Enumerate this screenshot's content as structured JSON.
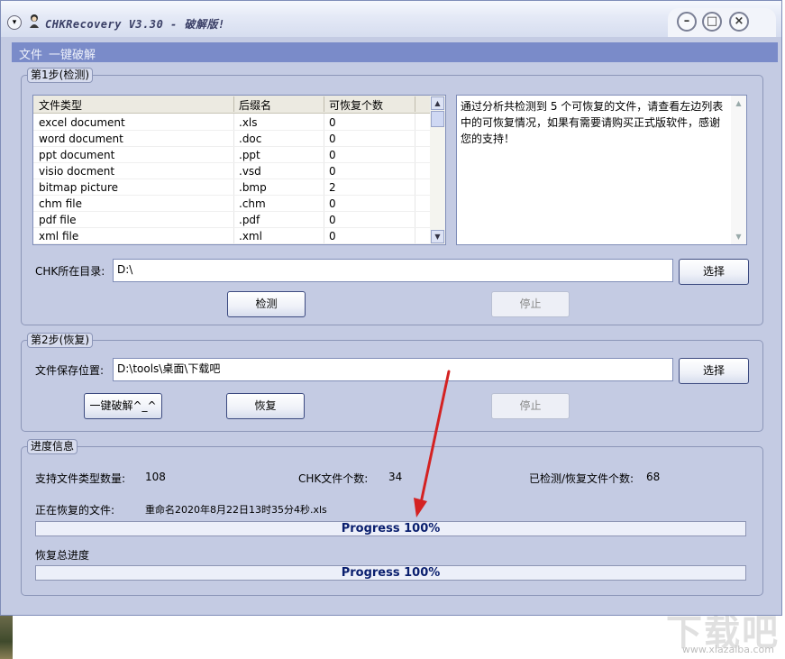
{
  "window": {
    "title": "CHKRecovery V3.30 - 破解版!"
  },
  "menu": [
    "文件",
    "一键破解"
  ],
  "step1": {
    "title": "第1步(检测)",
    "columns": [
      "文件类型",
      "后缀名",
      "可恢复个数"
    ],
    "rows": [
      [
        "excel document",
        ".xls",
        "0"
      ],
      [
        "word document",
        ".doc",
        "0"
      ],
      [
        "ppt document",
        ".ppt",
        "0"
      ],
      [
        "visio docment",
        ".vsd",
        "0"
      ],
      [
        "bitmap picture",
        ".bmp",
        "2"
      ],
      [
        "chm file",
        ".chm",
        "0"
      ],
      [
        "pdf file",
        ".pdf",
        "0"
      ],
      [
        "xml file",
        ".xml",
        "0"
      ]
    ],
    "info_text": "通过分析共检测到 5 个可恢复的文件，请查看左边列表中的可恢复情况，如果有需要请购买正式版软件，感谢您的支持！",
    "chk_dir_label": "CHK所在目录:",
    "chk_dir_value": "D:\\",
    "browse_label": "选择",
    "detect_label": "检测",
    "stop_label": "停止"
  },
  "step2": {
    "title": "第2步(恢复)",
    "save_label": "文件保存位置:",
    "save_value": "D:\\tools\\桌面\\下载吧",
    "browse_label": "选择",
    "crack_label": "一键破解^_^",
    "recover_label": "恢复",
    "stop_label": "停止"
  },
  "progress": {
    "title": "进度信息",
    "supported_types_label": "支持文件类型数量:",
    "supported_types_value": "108",
    "chk_count_label": "CHK文件个数:",
    "chk_count_value": "34",
    "detected_label": "已检测/恢复文件个数:",
    "detected_value": "68",
    "current_file_label": "正在恢复的文件:",
    "current_file_value": "重命名2020年8月22日13时35分4秒.xls",
    "file_progress_text": "Progress 100%",
    "file_progress_value": 1.0,
    "total_label": "恢复总进度",
    "total_progress_text": "Progress 100%",
    "total_progress_value": 1.0
  },
  "colors": {
    "menubar": "#7a8bc9",
    "window_bg": "#c4cbe3",
    "progress_text": "#0a1f6e",
    "arrow": "#d42222"
  },
  "watermark": {
    "big": "下载吧",
    "small": "www.xiazaiba.com"
  }
}
